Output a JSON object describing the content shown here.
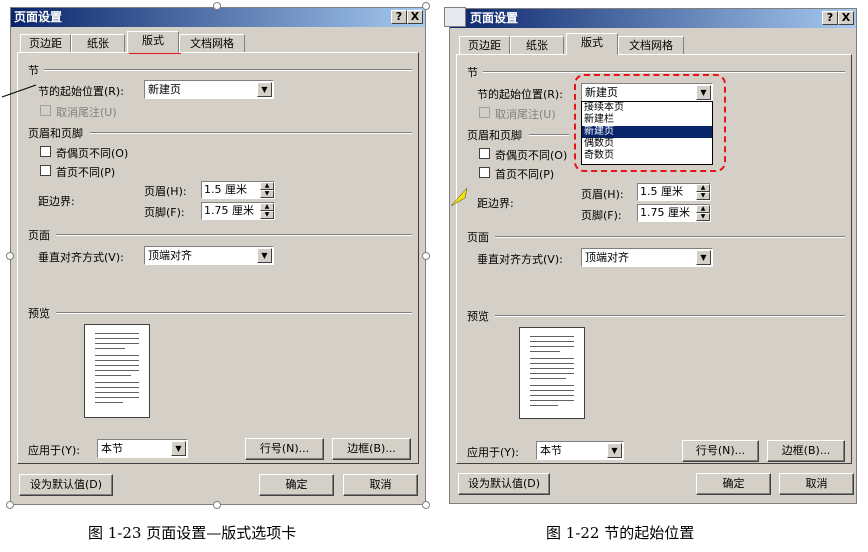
{
  "left": {
    "title": "页面设置",
    "help_btn": "?",
    "close_btn": "X",
    "tabs": [
      "页边距",
      "纸张",
      "版式",
      "文档网格"
    ],
    "section_label": "节",
    "section_start_label": "节的起始位置(R):",
    "section_start_value": "新建页",
    "suppress_endnotes": "取消尾注(U)",
    "header_footer_label": "页眉和页脚",
    "odd_even": "奇偶页不同(O)",
    "first_page": "首页不同(P)",
    "from_edge": "距边界:",
    "header_label": "页眉(H):",
    "header_value": "1.5 厘米",
    "footer_label": "页脚(F):",
    "footer_value": "1.75 厘米",
    "page_label": "页面",
    "valign_label": "垂直对齐方式(V):",
    "valign_value": "顶端对齐",
    "preview_label": "预览",
    "apply_label": "应用于(Y):",
    "apply_value": "本节",
    "line_numbers": "行号(N)...",
    "borders": "边框(B)...",
    "default_btn": "设为默认值(D)",
    "ok_btn": "确定",
    "cancel_btn": "取消"
  },
  "right": {
    "title": "页面设置",
    "help_btn": "?",
    "close_btn": "X",
    "tabs": [
      "页边距",
      "纸张",
      "版式",
      "文档网格"
    ],
    "section_label": "节",
    "section_start_label": "节的起始位置(R):",
    "section_start_value": "新建页",
    "dropdown_options": [
      "接续本页",
      "新建栏",
      "新建页",
      "偶数页",
      "奇数页"
    ],
    "suppress_endnotes": "取消尾注(U)",
    "header_footer_label": "页眉和页脚",
    "odd_even": "奇偶页不同(O)",
    "first_page": "首页不同(P)",
    "from_edge": "距边界:",
    "header_label": "页眉(H):",
    "header_value": "1.5 厘米",
    "footer_label": "页脚(F):",
    "footer_value": "1.75 厘米",
    "page_label": "页面",
    "valign_label": "垂直对齐方式(V):",
    "valign_value": "顶端对齐",
    "preview_label": "预览",
    "apply_label": "应用于(Y):",
    "apply_value": "本节",
    "line_numbers": "行号(N)...",
    "borders": "边框(B)...",
    "default_btn": "设为默认值(D)",
    "ok_btn": "确定",
    "cancel_btn": "取消"
  },
  "captions": {
    "left": "图 1-23 页面设置—版式选项卡",
    "right": "图 1-22 节的起始位置"
  },
  "colors": {
    "titlebar": "#0a246a",
    "dialog_bg": "#d4d0c8",
    "highlight_dash": "#e8141b",
    "tab_underline": "#e8141b"
  }
}
